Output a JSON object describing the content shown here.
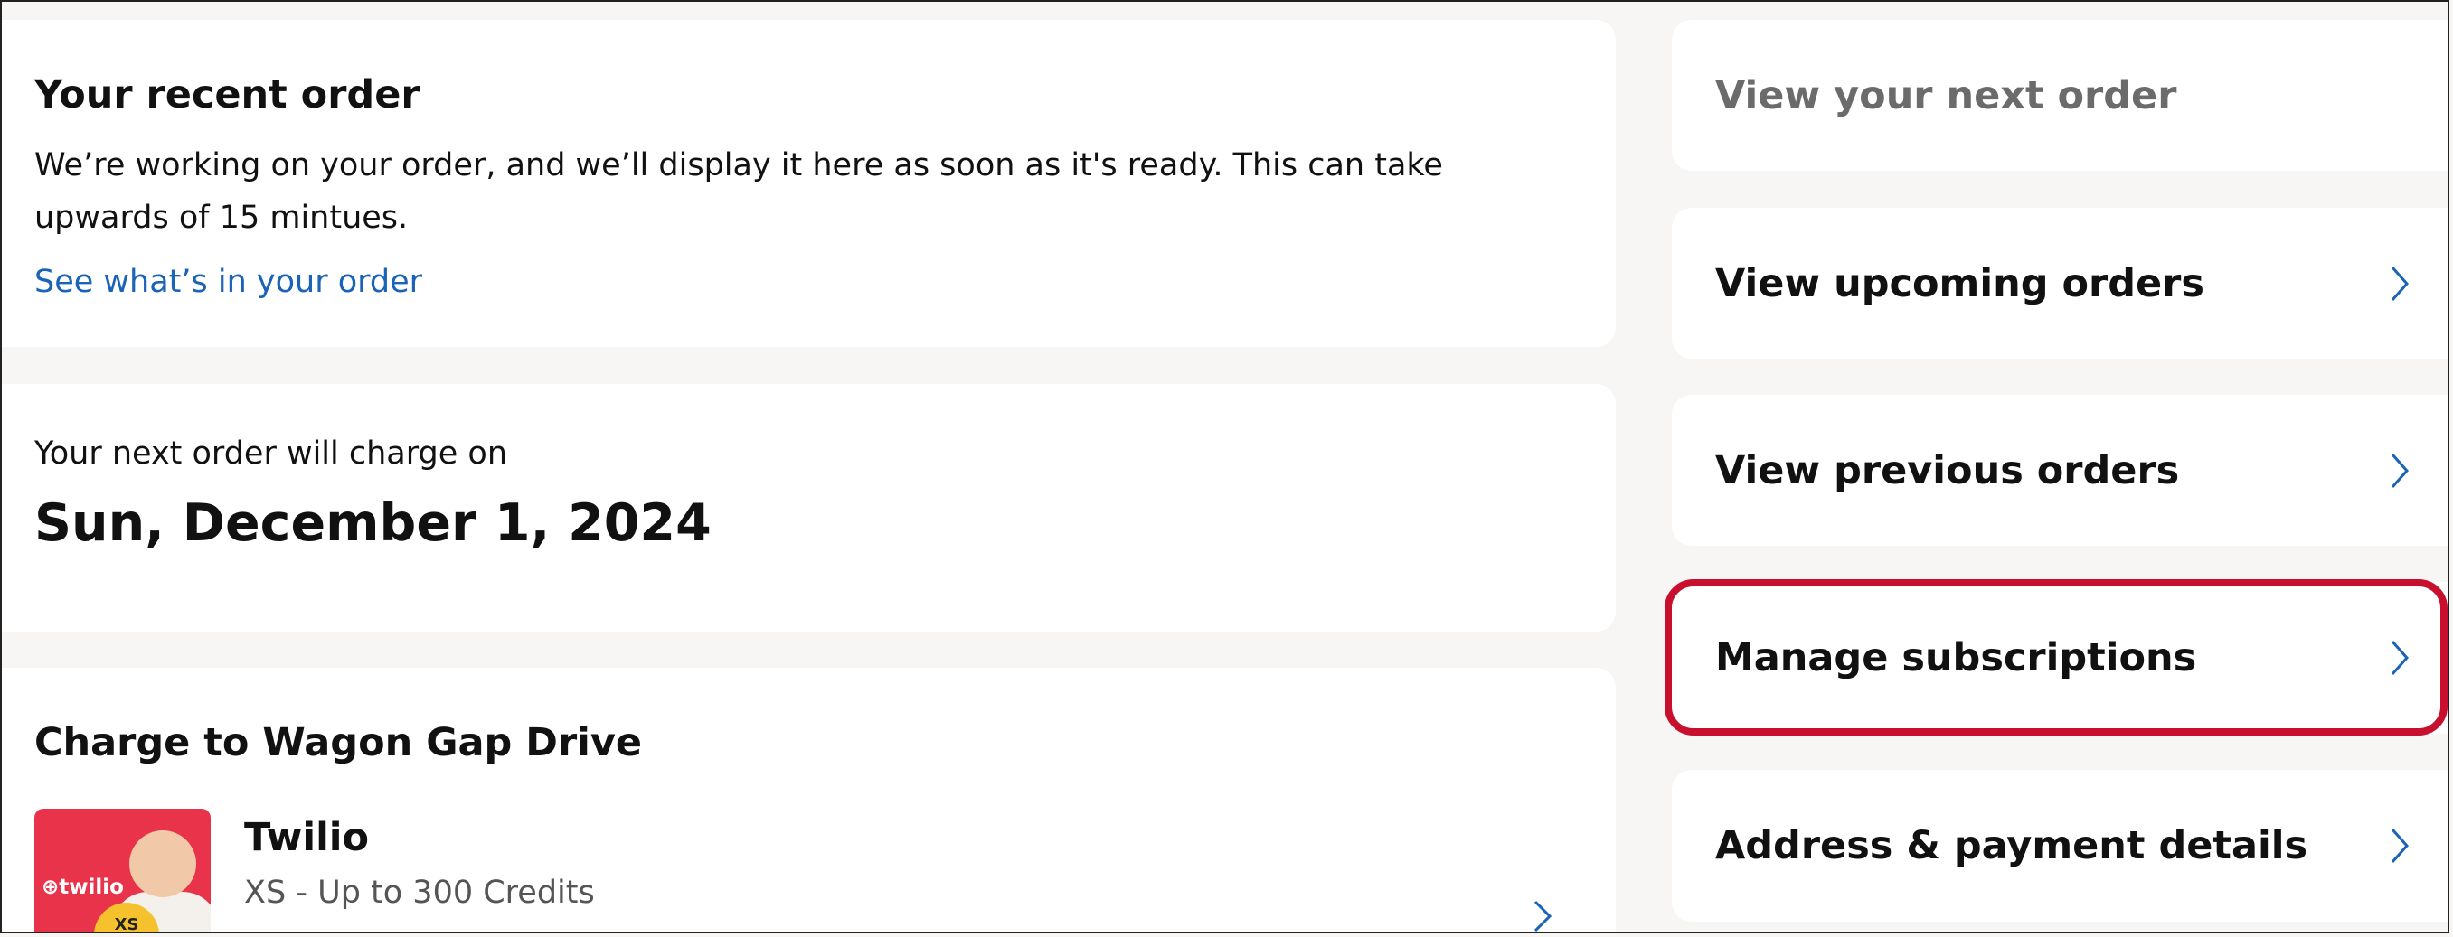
{
  "recent_order": {
    "title": "Your recent order",
    "message": "We’re working on your order, and we’ll display it here as soon as it's ready. This can take upwards of 15 mintues.",
    "link": "See what’s in your order"
  },
  "next_charge": {
    "label": "Your next order will charge on",
    "date": "Sun, December 1, 2024"
  },
  "charge_to": {
    "title": "Charge to Wagon Gap Drive",
    "product": {
      "logo_text": "⊕twilio",
      "badge": "XS",
      "name": "Twilio",
      "plan": "XS - Up to 300 Credits"
    }
  },
  "side_nav": {
    "next_order": "View your next order",
    "upcoming": "View upcoming orders",
    "previous": "View previous orders",
    "subscriptions": "Manage subscriptions",
    "address_payment": "Address & payment details"
  },
  "colors": {
    "link": "#1a63b7",
    "highlight": "#c8102e",
    "thumbnail": "#e8334a"
  }
}
